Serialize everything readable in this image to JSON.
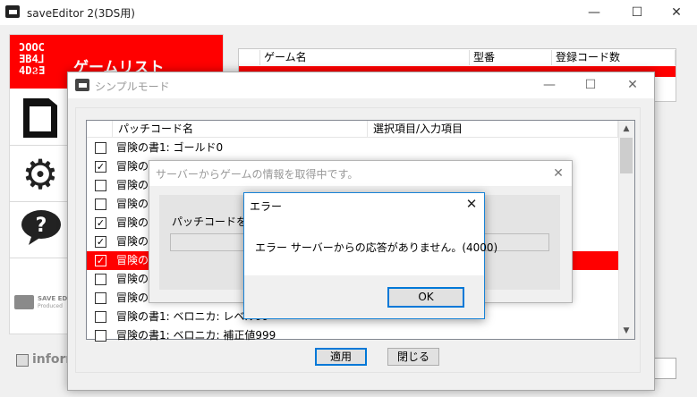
{
  "main_window": {
    "title": "saveEditor 2(3DS用)",
    "controls": {
      "minimize": "—",
      "maximize": "☐",
      "close": "✕"
    }
  },
  "sidebar": {
    "brand_logo": "ϽOOϹ\nƎB4⅃\n4DϨƎ",
    "brand_title": "ゲームリスト",
    "nav_icons": [
      "sd-card-icon",
      "gear-icon",
      "help-icon"
    ],
    "footer_logo_line1": "SAVE ED",
    "footer_logo_line2": "Produced",
    "info_label": "inform"
  },
  "game_table": {
    "columns": [
      "",
      "ゲーム名",
      "型番",
      "登録コード数"
    ]
  },
  "simple_mode": {
    "title": "シンプルモード",
    "controls": {
      "minimize": "—",
      "maximize": "☐",
      "close": "✕"
    },
    "columns": [
      "パッチコード名",
      "選択項目/入力項目"
    ],
    "rows": [
      {
        "checked": false,
        "name": "冒険の書1: ゴールド0",
        "selected": false
      },
      {
        "checked": true,
        "name": "冒険の",
        "selected": false
      },
      {
        "checked": false,
        "name": "冒険の",
        "selected": false
      },
      {
        "checked": false,
        "name": "冒険の",
        "selected": false
      },
      {
        "checked": true,
        "name": "冒険の",
        "selected": false
      },
      {
        "checked": true,
        "name": "冒険の",
        "selected": false
      },
      {
        "checked": true,
        "name": "冒険の",
        "selected": true
      },
      {
        "checked": false,
        "name": "冒険の",
        "selected": false
      },
      {
        "checked": false,
        "name": "冒険の",
        "selected": false
      },
      {
        "checked": false,
        "name": "冒険の書1: ベロニカ: レベル99",
        "selected": false
      },
      {
        "checked": false,
        "name": "冒険の書1: ベロニカ: 補正値999",
        "selected": false
      }
    ],
    "apply_label": "適用",
    "close_label": "閉じる"
  },
  "server_dialog": {
    "title": "サーバーからゲームの情報を取得中です。",
    "close": "✕",
    "message": "パッチコードを使用"
  },
  "error_dialog": {
    "title": "エラー",
    "close": "✕",
    "message": "エラー サーバーからの応答がありません。(4000)",
    "ok_label": "OK"
  },
  "check_mark": "✓",
  "scroll_up": "▲",
  "scroll_down": "▼",
  "colors": {
    "brand_red": "#ff0000",
    "focus_blue": "#0078d7"
  }
}
